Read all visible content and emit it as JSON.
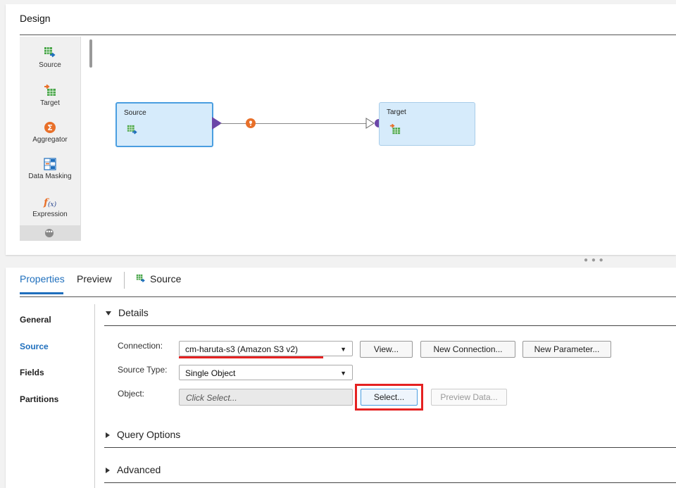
{
  "design": {
    "title": "Design",
    "palette": [
      {
        "label": "Source",
        "icon": "source-icon"
      },
      {
        "label": "Target",
        "icon": "target-icon"
      },
      {
        "label": "Aggregator",
        "icon": "aggregator-icon"
      },
      {
        "label": "Data Masking",
        "icon": "data-masking-icon"
      },
      {
        "label": "Expression",
        "icon": "expression-icon"
      }
    ],
    "nodes": {
      "source": {
        "label": "Source"
      },
      "target": {
        "label": "Target"
      }
    }
  },
  "properties": {
    "tabs": {
      "properties": "Properties",
      "preview": "Preview",
      "source": "Source"
    },
    "nav": [
      "General",
      "Source",
      "Fields",
      "Partitions"
    ],
    "active_nav": "Source",
    "sections": {
      "details": "Details",
      "query_options": "Query Options",
      "advanced": "Advanced"
    },
    "fields": {
      "connection_label": "Connection:",
      "connection_value": "cm-haruta-s3 (Amazon S3 v2)",
      "source_type_label": "Source Type:",
      "source_type_value": "Single Object",
      "object_label": "Object:",
      "object_placeholder": "Click Select..."
    },
    "buttons": {
      "view": "View...",
      "new_connection": "New Connection...",
      "new_parameter": "New Parameter...",
      "select": "Select...",
      "preview_data": "Preview Data..."
    }
  },
  "colors": {
    "accent": "#1f6fbd",
    "highlight": "#e52222",
    "node_fill": "#d6ebfb"
  }
}
